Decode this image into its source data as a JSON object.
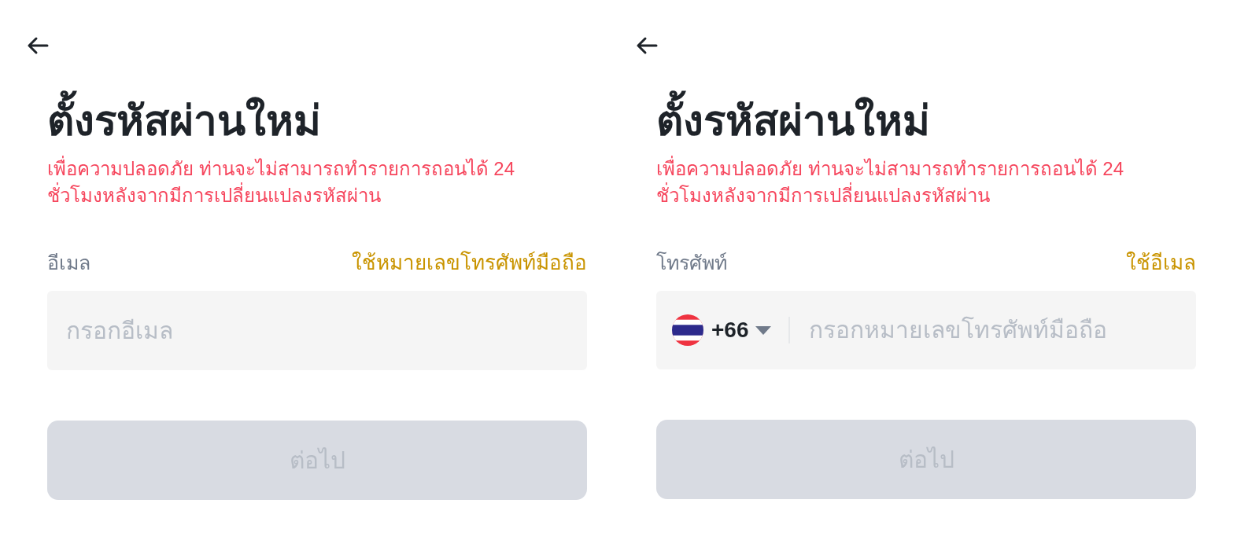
{
  "panels": [
    {
      "title": "ตั้งรหัสผ่านใหม่",
      "notice": "เพื่อความปลอดภัย ท่านจะไม่สามารถทำรายการถอนได้ 24 ชั่วโมงหลังจากมีการเปลี่ยนแปลงรหัสผ่าน",
      "field": {
        "kind": "email",
        "label": "อีเมล",
        "switch_link": "ใช้หมายเลขโทรศัพท์มือถือ",
        "placeholder": "กรอกอีเมล"
      },
      "submit": {
        "label": "ต่อไป",
        "disabled": true
      }
    },
    {
      "title": "ตั้งรหัสผ่านใหม่",
      "notice": "เพื่อความปลอดภัย ท่านจะไม่สามารถทำรายการถอนได้ 24 ชั่วโมงหลังจากมีการเปลี่ยนแปลงรหัสผ่าน",
      "field": {
        "kind": "phone",
        "label": "โทรศัพท์",
        "switch_link": "ใช้อีเมล",
        "country_code": "+66",
        "placeholder": "กรอกหมายเลขโทรศัพท์มือถือ"
      },
      "submit": {
        "label": "ต่อไป",
        "disabled": true
      }
    }
  ]
}
